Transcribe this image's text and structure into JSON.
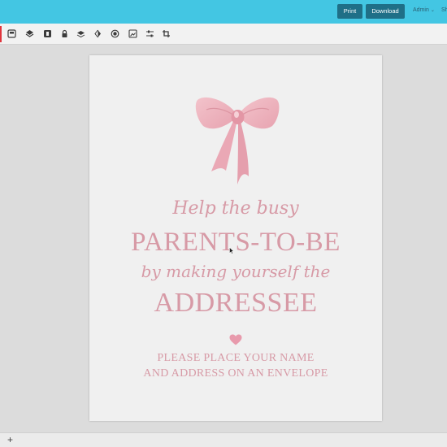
{
  "topbar": {
    "print_label": "Print",
    "download_label": "Download",
    "admin_label": "Admin",
    "share_label": "Sh",
    "color": "#43c6e3"
  },
  "toolbar": {
    "tools": [
      "template-icon",
      "layers-icon",
      "lock-badge-icon",
      "lock-icon",
      "stack-icon",
      "contrast-icon",
      "filter-icon",
      "image-edit-icon",
      "sliders-icon",
      "crop-icon"
    ]
  },
  "document": {
    "line1": "Help the busy",
    "line2": "PARENTS-TO-BE",
    "line3": "by making yourself the",
    "line4": "ADDRESSEE",
    "line5": "PLEASE PLACE YOUR NAME",
    "line6": "AND ADDRESS ON AN ENVELOPE",
    "text_color": "#d79aa6",
    "heart_color": "#e89aac"
  },
  "bottombar": {
    "add_label": "+"
  }
}
